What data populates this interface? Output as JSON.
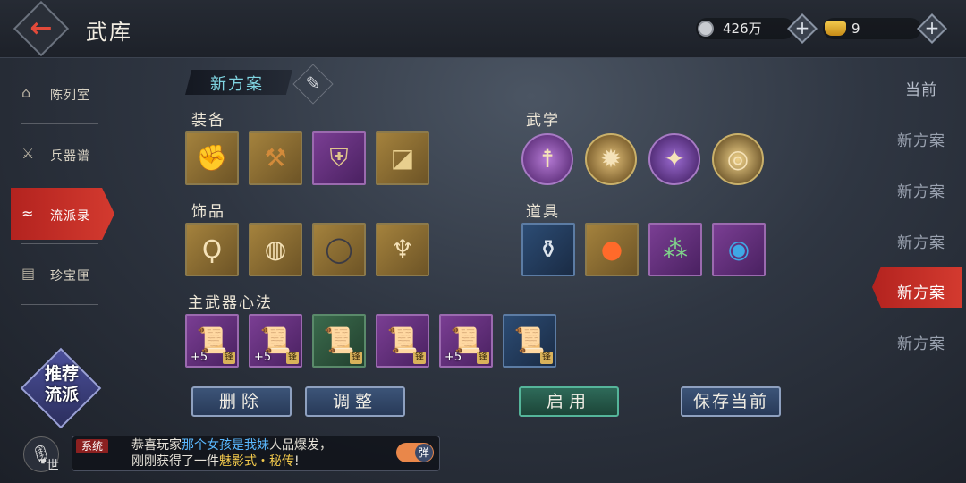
{
  "header": {
    "title": "武库",
    "silver": "426万",
    "gold": "9"
  },
  "nav": [
    {
      "label": "陈列室",
      "icon": "pavilion-icon"
    },
    {
      "label": "兵器谱",
      "icon": "weapon-book-icon"
    },
    {
      "label": "流派录",
      "icon": "school-icon"
    },
    {
      "label": "珍宝匣",
      "icon": "treasure-box-icon"
    }
  ],
  "recommend": {
    "line1": "推荐",
    "line2": "流派"
  },
  "plan_tab": {
    "name": "新方案"
  },
  "sections": {
    "equipment": "装备",
    "martial": "武学",
    "accessory": "饰品",
    "props": "道具",
    "heart_method": "主武器心法"
  },
  "heart_method_items": [
    {
      "level": "+5",
      "rarity": "purple"
    },
    {
      "level": "+5",
      "rarity": "purple"
    },
    {
      "level": "",
      "rarity": "green"
    },
    {
      "level": "",
      "rarity": "purple"
    },
    {
      "level": "+5",
      "rarity": "purple"
    },
    {
      "level": "",
      "rarity": "blue"
    }
  ],
  "buttons": {
    "delete": "删除",
    "adjust": "调整",
    "enable": "启用",
    "save": "保存当前"
  },
  "plans": [
    "当前",
    "新方案",
    "新方案",
    "新方案",
    "新方案",
    "新方案"
  ],
  "chat": {
    "channel_tag": "系统",
    "world_label": "世",
    "message_prefix": "恭喜玩家",
    "player_name": "那个女孩是我妹",
    "message_mid": "人品爆发，",
    "message_line2": "刚刚获得了一件",
    "item_name": "魅影式・秘传",
    "message_end": "!",
    "toggle_label": "弹"
  }
}
